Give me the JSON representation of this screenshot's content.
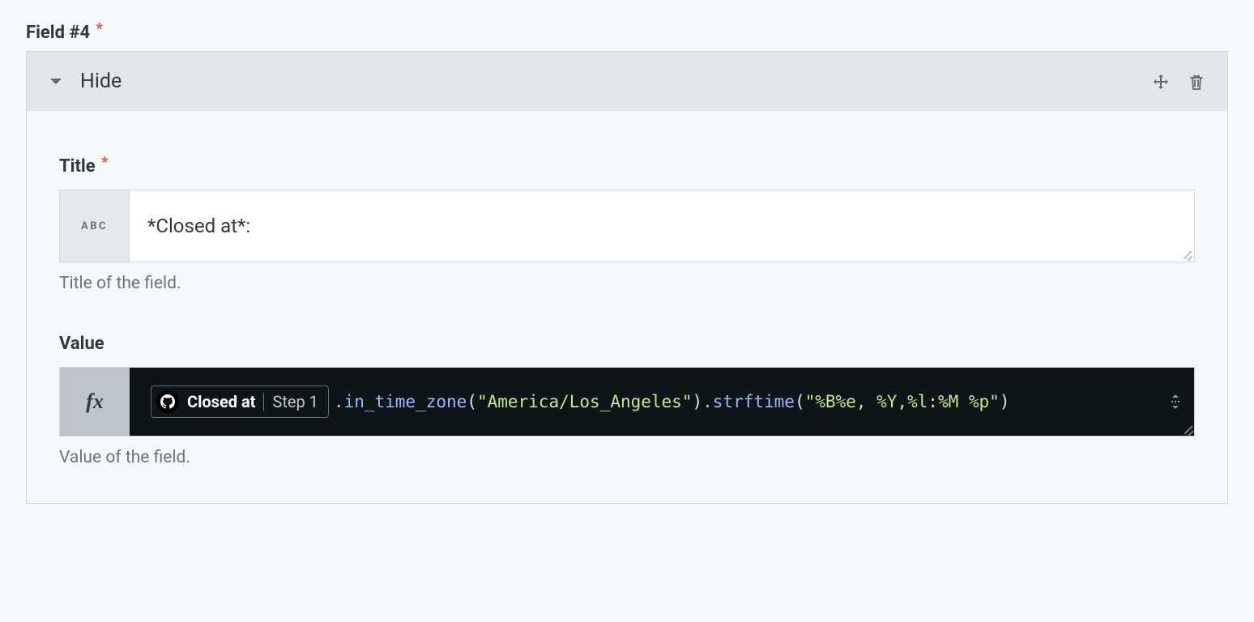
{
  "section": {
    "label": "Field #4"
  },
  "header": {
    "toggle_label": "Hide"
  },
  "fields": {
    "title": {
      "label": "Title",
      "prefix_badge": "ABC",
      "value": "*Closed at*:",
      "helper": "Title of the field."
    },
    "value": {
      "label": "Value",
      "prefix_badge": "fx",
      "pill": {
        "source_icon": "github",
        "label": "Closed at",
        "step": "Step 1"
      },
      "code_tokens": {
        "dot1": ".",
        "fn1": "in_time_zone",
        "lp1": "(",
        "str1": "\"America/Los_Angeles\"",
        "rp1": ")",
        "dot2": ".",
        "fn2": "strftime",
        "lp2": "(",
        "str2": "\"%B%e, %Y,%l:%M %p\"",
        "rp2": ")"
      },
      "helper": "Value of the field."
    }
  }
}
